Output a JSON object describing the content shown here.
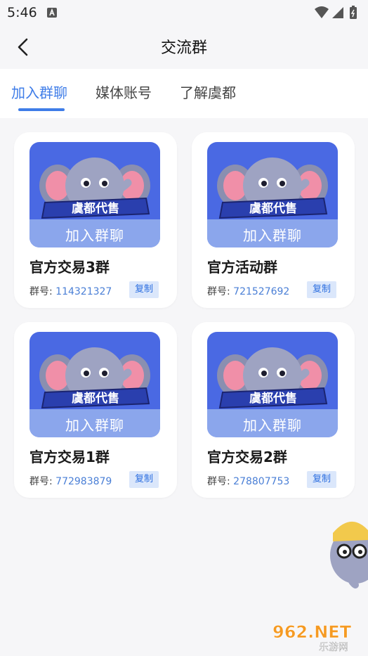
{
  "status_bar": {
    "time": "5:46"
  },
  "header": {
    "title": "交流群"
  },
  "tabs": [
    {
      "label": "加入群聊",
      "active": true
    },
    {
      "label": "媒体账号",
      "active": false
    },
    {
      "label": "了解虞都",
      "active": false
    }
  ],
  "cards": [
    {
      "image_banner": "虞都代售",
      "image_overlay": "加入群聊",
      "title": "官方交易3群",
      "number_label": "群号:",
      "number": "114321327",
      "copy_label": "复制"
    },
    {
      "image_banner": "虞都代售",
      "image_overlay": "加入群聊",
      "title": "官方活动群",
      "number_label": "群号:",
      "number": "721527692",
      "copy_label": "复制"
    },
    {
      "image_banner": "虞都代售",
      "image_overlay": "加入群聊",
      "title": "官方交易1群",
      "number_label": "群号:",
      "number": "772983879",
      "copy_label": "复制"
    },
    {
      "image_banner": "虞都代售",
      "image_overlay": "加入群聊",
      "title": "官方交易2群",
      "number_label": "群号:",
      "number": "278807753",
      "copy_label": "复制"
    }
  ],
  "watermark": {
    "brand": "962.NET",
    "sub": "乐游网"
  },
  "colors": {
    "accent": "#3f7de8",
    "card_image_bg": "#4a69e3",
    "copy_bg": "#dbe7fb"
  }
}
